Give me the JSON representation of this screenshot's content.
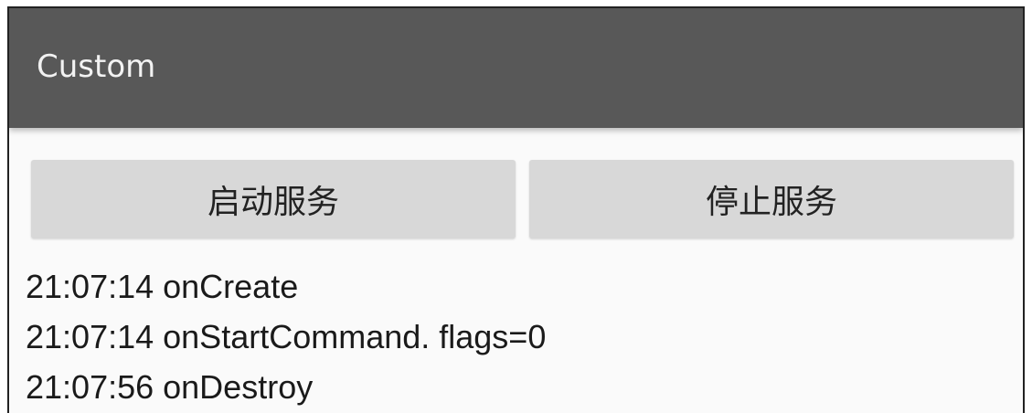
{
  "app_bar": {
    "title": "Custom",
    "background_color": "#585858"
  },
  "buttons": {
    "start_label": "启动服务",
    "stop_label": "停止服务"
  },
  "log": {
    "lines": [
      "21:07:14 onCreate",
      "21:07:14 onStartCommand. flags=0",
      "21:07:56 onDestroy"
    ]
  }
}
